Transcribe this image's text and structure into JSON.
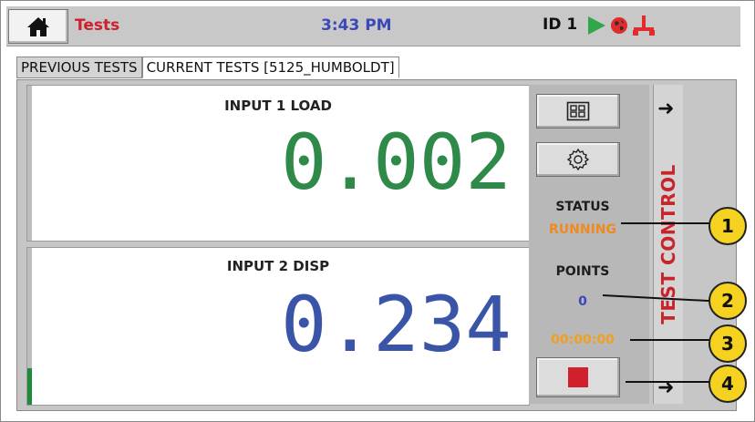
{
  "header": {
    "title": "Tests",
    "time": "3:43 PM",
    "device_id": "ID 1",
    "home_icon": "home-icon",
    "colors": {
      "title": "#d0202c",
      "time": "#3a48b8",
      "play": "#2fa84a"
    }
  },
  "tabs": [
    {
      "label": "PREVIOUS TESTS",
      "active": false
    },
    {
      "label": "CURRENT TESTS [5125_HUMBOLDT]",
      "active": true
    }
  ],
  "inputs": [
    {
      "label": "INPUT 1 LOAD",
      "value": "0.002",
      "color": "#2f8a4a"
    },
    {
      "label": "INPUT 2 DISP",
      "value": "0.234",
      "color": "#3a54a8"
    }
  ],
  "side": {
    "status_label": "STATUS",
    "status_value": "RUNNING",
    "points_label": "POINTS",
    "points_value": "0",
    "elapsed": "00:00:00",
    "test_control_label": "TEST CONTROL",
    "colors": {
      "status": "#f08a1e",
      "points": "#3a48b8",
      "elapsed": "#f0a01e",
      "stop": "#d0202c",
      "test_control": "#c8242c"
    }
  },
  "callouts": [
    "1",
    "2",
    "3",
    "4"
  ]
}
